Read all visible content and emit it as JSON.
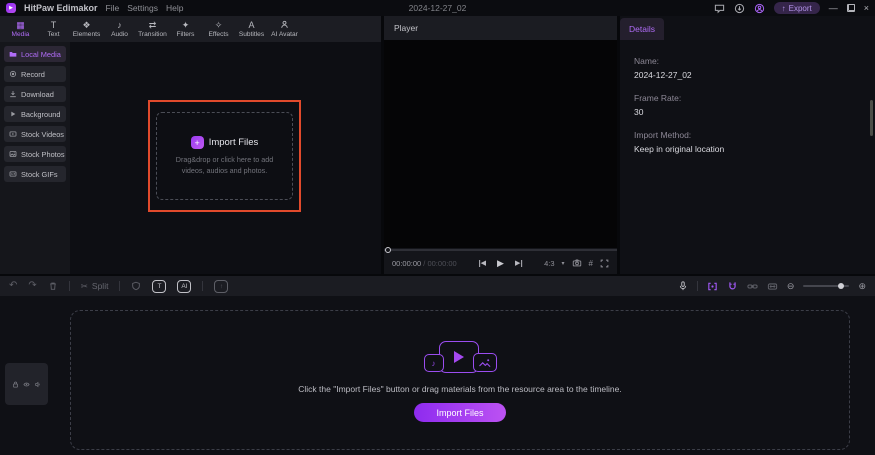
{
  "titlebar": {
    "app_name": "HitPaw Edimakor",
    "menus": [
      "File",
      "Settings",
      "Help"
    ],
    "document_title": "2024-12-27_02",
    "export_label": "Export"
  },
  "icons": {
    "logo": "▶",
    "media": "▦",
    "text": "T",
    "elements": "❖",
    "audio": "♪",
    "transition": "⇄",
    "filters": "✦",
    "effects": "✧",
    "subtitles": "A",
    "undo": "↶",
    "redo": "↷",
    "scissors": "✂",
    "tts": "T",
    "ai": "AI",
    "upload": "↑",
    "grid": "#",
    "caret_down": "▾",
    "prev_frame": "◀",
    "play": "▶",
    "next_frame": "▶",
    "zoom_out": "⊖",
    "zoom_in": "⊕",
    "plus": "+",
    "note": "♪",
    "export_arrow": "↑",
    "minimize": "—",
    "close": "×"
  },
  "ribbon": {
    "tabs": [
      {
        "label": "Media",
        "active": true
      },
      {
        "label": "Text"
      },
      {
        "label": "Elements"
      },
      {
        "label": "Audio"
      },
      {
        "label": "Transition"
      },
      {
        "label": "Filters"
      },
      {
        "label": "Effects"
      },
      {
        "label": "Subtitles"
      },
      {
        "label": "AI Avatar"
      }
    ]
  },
  "sidebar": {
    "items": [
      {
        "label": "Local Media",
        "icon": "folder-icon",
        "active": true
      },
      {
        "label": "Record",
        "icon": "record-icon"
      },
      {
        "label": "Download",
        "icon": "download-icon"
      },
      {
        "label": "Background",
        "icon": "background-icon"
      },
      {
        "label": "Stock Videos",
        "icon": "video-icon"
      },
      {
        "label": "Stock Photos",
        "icon": "photo-icon"
      },
      {
        "label": "Stock GIFs",
        "icon": "gif-icon"
      }
    ]
  },
  "media_panel": {
    "import_title": "Import Files",
    "caption_line1": "Drag&drop or click here to add",
    "caption_line2": "videos, audios and photos."
  },
  "player": {
    "title": "Player",
    "time_current": "00:00:00",
    "time_separator": "/",
    "time_total": "00:00:00",
    "aspect_ratio": "4:3"
  },
  "details": {
    "tab_label": "Details",
    "fields": [
      {
        "label": "Name:",
        "value": "2024-12-27_02"
      },
      {
        "label": "Frame Rate:",
        "value": "30"
      },
      {
        "label": "Import Method:",
        "value": "Keep in original location"
      }
    ]
  },
  "timeline_toolbar": {
    "split_label": "Split"
  },
  "timeline": {
    "hint": "Click the \"Import Files\" button or drag materials from the resource area to the timeline.",
    "import_button_label": "Import Files"
  },
  "colors": {
    "accent_purple": "#a259f7",
    "annotation_red": "#e14a2c",
    "button_gradient_start": "#8e2bef",
    "button_gradient_end": "#bc52f2",
    "panel_bg": "#0f1015",
    "toolbar_bg": "#1c1d23"
  }
}
